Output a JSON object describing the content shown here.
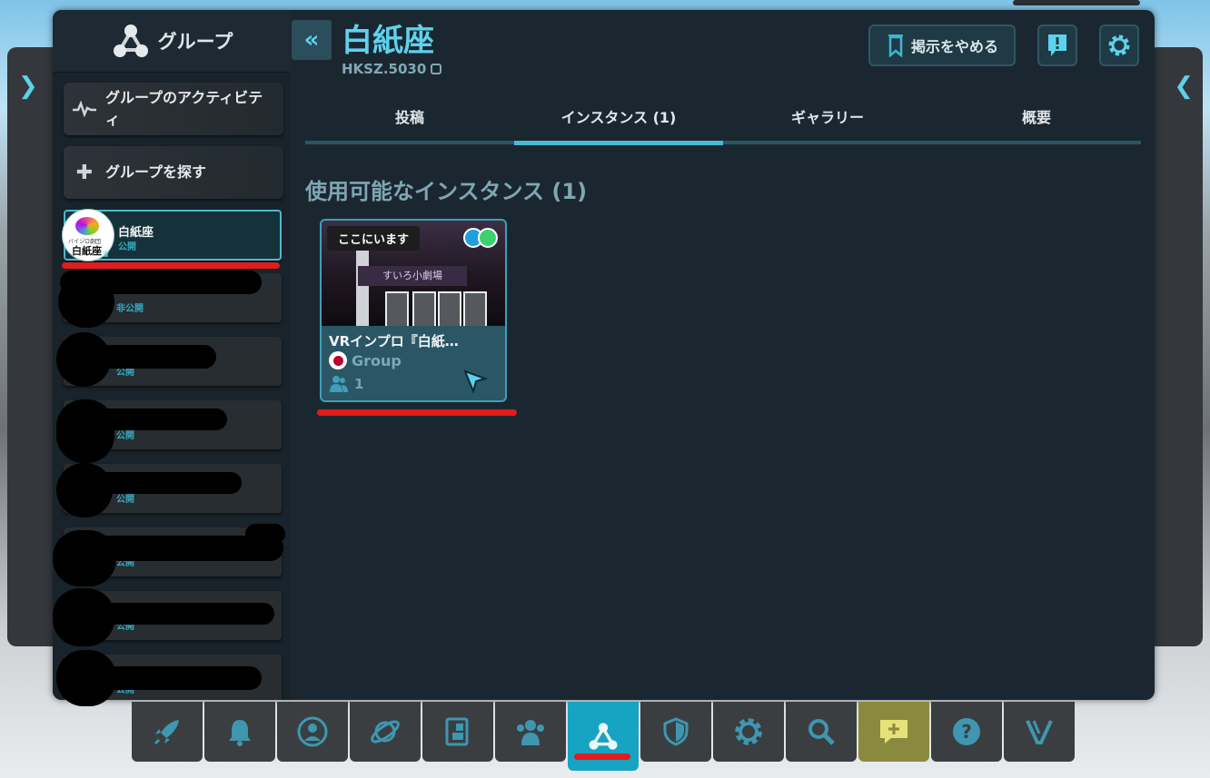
{
  "sidebar": {
    "title": "グループ",
    "activity_label": "グループのアクティビティ",
    "find_label": "グループを探す",
    "groups": [
      {
        "name": "白紙座",
        "status": "公開"
      },
      {
        "name": "",
        "status": "非公開"
      },
      {
        "name": "",
        "status": "公開"
      },
      {
        "name": "",
        "status": "公開"
      },
      {
        "name": "",
        "status": "公開"
      },
      {
        "name": "",
        "status": "公開"
      },
      {
        "name": "",
        "status": "公開"
      },
      {
        "name": "",
        "status": "公開"
      }
    ],
    "avatar_tiny_text": "バイン゚ロ劇団",
    "avatar_kanji": "白紙座"
  },
  "header": {
    "group_title": "白紙座",
    "group_code": "HKSZ.5030",
    "unrepresent_label": "掲示をやめる"
  },
  "tabs": [
    {
      "label": "投稿"
    },
    {
      "label": "インスタンス (1)"
    },
    {
      "label": "ギャラリー"
    },
    {
      "label": "概要"
    }
  ],
  "section_title": "使用可能なインスタンス (1)",
  "instance": {
    "badge": "ここにいます",
    "sign_text": "すいろ小劇場",
    "name": "VRインプロ『白紙…",
    "type": "Group",
    "user_count": "1"
  },
  "dock": {
    "icons": [
      "rocket-icon",
      "bell-icon",
      "user-icon",
      "planet-icon",
      "worlds-icon",
      "friends-icon",
      "groups-icon",
      "shield-icon",
      "gear-icon",
      "search-icon",
      "chat-add-icon",
      "help-icon",
      "vrchat-icon"
    ],
    "active_index": 6
  },
  "colors": {
    "accent": "#5ed2ec",
    "panel": "#1b2730",
    "redline": "#e11c1c"
  }
}
